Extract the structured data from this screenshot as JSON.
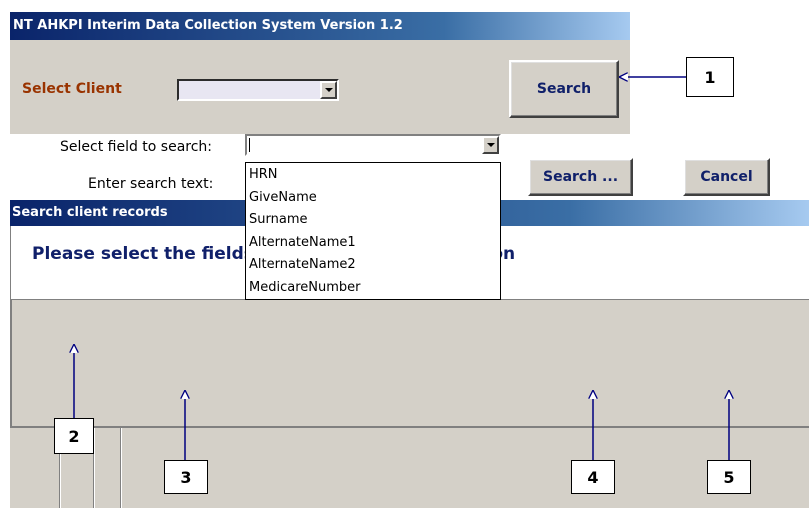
{
  "window1": {
    "title": "NT AHKPI Interim Data Collection System Version 1.2",
    "select_client_label": "Select Client",
    "client_combo_value": "",
    "search_button_label": "Search"
  },
  "window2": {
    "title": "Search client records",
    "instructions": "Please select the fields that you wish to search on",
    "field_label": "Select field to search:",
    "field_combo_value": "",
    "search_text_label": "Enter search text:",
    "field_options": [
      "HRN",
      "GiveName",
      "Surname",
      "AlternateName1",
      "AlternateName2",
      "MedicareNumber"
    ],
    "search_button_label": "Search ...",
    "cancel_button_label": "Cancel"
  },
  "callouts": [
    "1",
    "2",
    "3",
    "4",
    "5"
  ],
  "colors": {
    "title_bar_start": "#0a246a",
    "title_bar_end": "#a6caf0",
    "window_face": "#d4d0c8",
    "button_text": "#10206a",
    "client_label": "#993300"
  }
}
